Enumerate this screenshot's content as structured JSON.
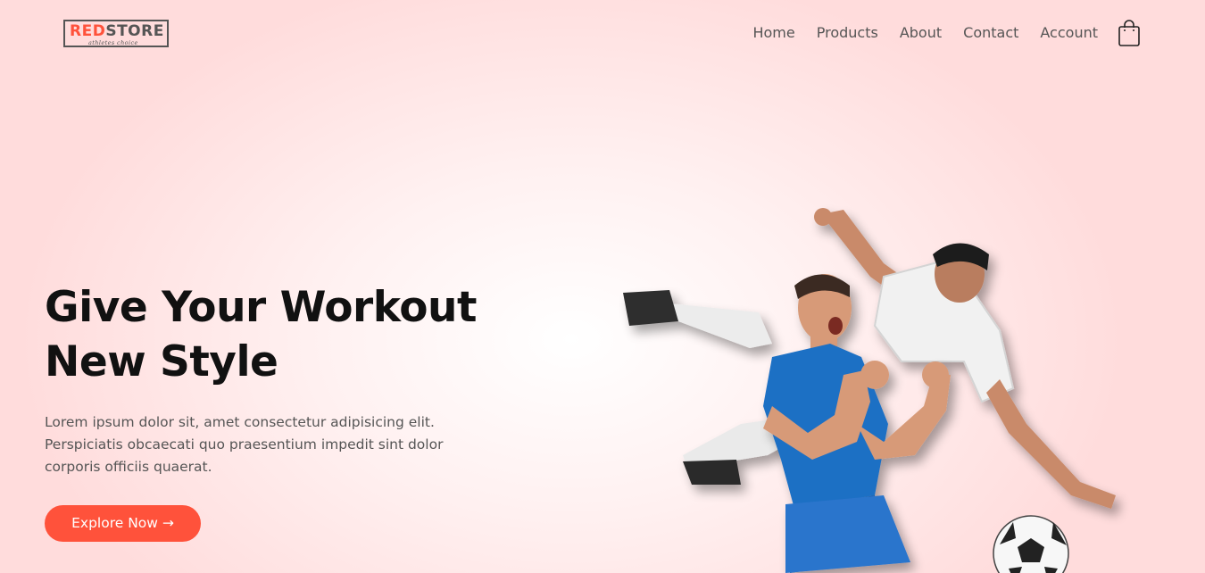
{
  "header": {
    "logo": {
      "part1": "RED",
      "part2": "STORE",
      "tagline": "athletes choice"
    },
    "nav": [
      "Home",
      "Products",
      "About",
      "Contact",
      "Account"
    ],
    "cart_icon": "shopping-bag-icon"
  },
  "hero": {
    "title_line1": "Give Your Workout",
    "title_line2": "New Style",
    "description": "Lorem ipsum dolor sit, amet consectetur adipisicing elit. Perspiciatis obcaecati quo praesentium impedit sint dolor corporis officiis quaerat.",
    "cta_label": "Explore Now →",
    "image_alt": "two football players"
  },
  "colors": {
    "accent": "#ff523b",
    "background": "#ffd9d9",
    "text": "#555555",
    "heading": "#111111"
  }
}
